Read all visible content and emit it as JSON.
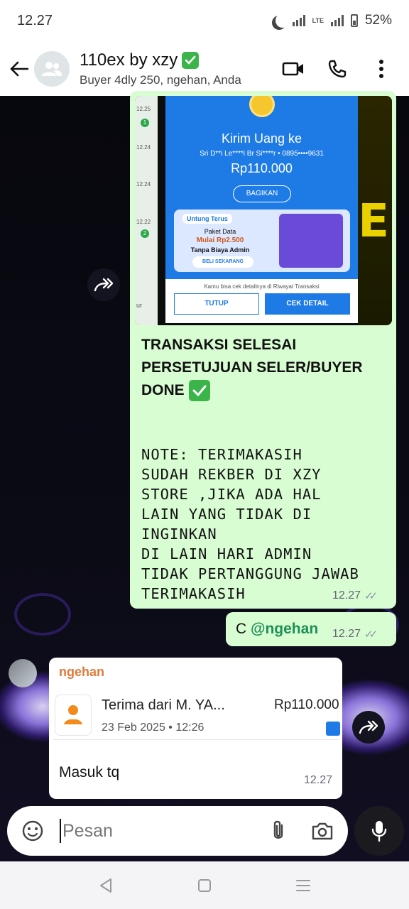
{
  "status": {
    "time": "12.27",
    "battery": "52%",
    "network": "LTE"
  },
  "header": {
    "title": "110ex by xzy",
    "subtitle": "Buyer 4dly 250, ngehan, Anda",
    "icons": [
      "back-arrow-icon",
      "group-avatar-icon",
      "video-call-icon",
      "phone-icon",
      "more-icon"
    ]
  },
  "receipt_image": {
    "strip_times": [
      "12.25",
      "12.24",
      "12.24",
      "12.22"
    ],
    "strip_badges": [
      "1",
      "2"
    ],
    "strip_word": "ur",
    "heading": "Kirim Uang ke",
    "recipient": "Sri D**i Le****i Br Si****r • 0895••••9631",
    "amount": "Rp110.000",
    "share_label": "BAGIKAN",
    "promo_tag": "Untung Terus",
    "promo_line1": "Paket Data",
    "promo_line2": "Mulai Rp2.500",
    "promo_line3": "Tanpa Biaya Admin",
    "promo_cta": "BELI SEKARANG",
    "footer_note": "Kamu bisa cek detailnya di Riwayat Transaksi",
    "btn_close": "TUTUP",
    "btn_detail": "CEK DETAIL",
    "deco_letter": "E"
  },
  "outgoing_main": {
    "bold_text": "TRANSAKSI SELESAI PERSETUJUAN SELER/BUYER DONE",
    "note_text": "NOTE: TERIMAKASIH\nSUDAH REKBER DI XZY\nSTORE ,JIKA ADA HAL\nLAIN YANG TIDAK DI\nINGINKAN\nDI LAIN HARI ADMIN\nTIDAK PERTANGGUNG JAWAB\nTERIMAKASIH",
    "time": "12.27"
  },
  "outgoing_c": {
    "prefix": "C ",
    "mention": "@ngehan",
    "time": "12.27"
  },
  "incoming": {
    "sender": "ngehan",
    "quote_title": "Terima dari M. YA...",
    "quote_date": "23 Feb 2025 • 12:26",
    "quote_amount": "Rp110.000",
    "text": "Masuk tq",
    "time": "12.27"
  },
  "input": {
    "placeholder": "Pesan"
  }
}
